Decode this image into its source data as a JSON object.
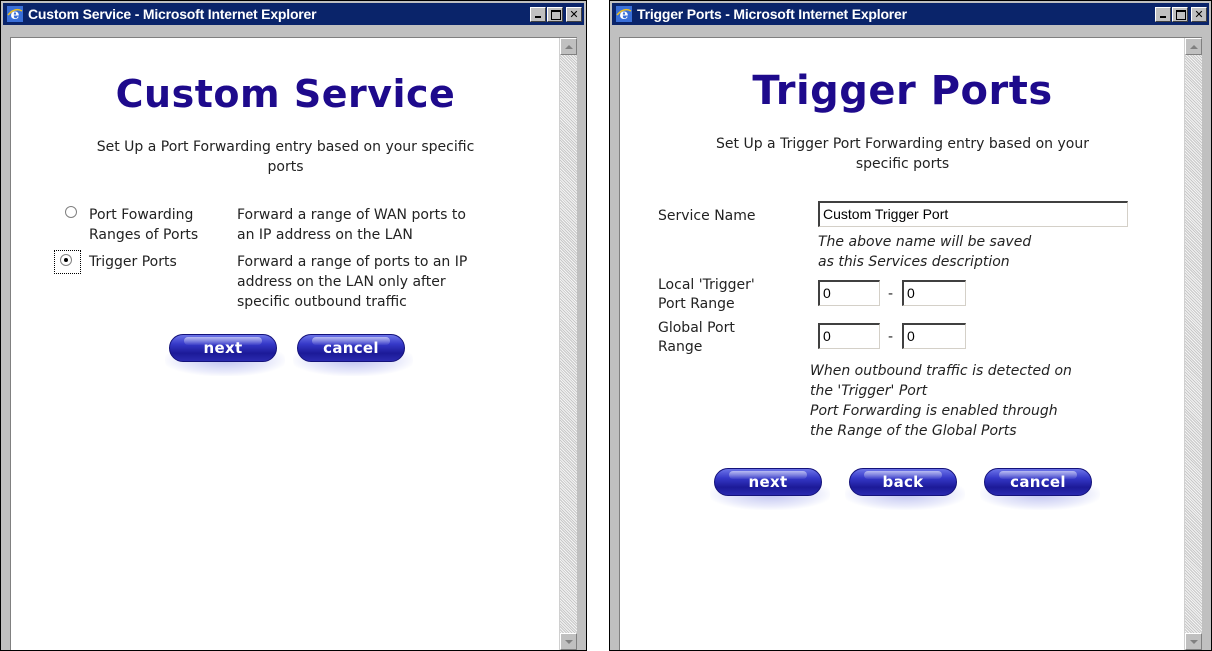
{
  "window1": {
    "title": "Custom Service - Microsoft Internet Explorer",
    "heading": "Custom Service",
    "intro_line1": "Set Up a Port Forwarding entry based on your specific",
    "intro_line2": "ports",
    "options": [
      {
        "label_line1": "Port Fowarding",
        "label_line2": "Ranges of Ports",
        "desc_line1": "Forward a range of WAN ports to",
        "desc_line2": "an IP address on the LAN",
        "desc_line3": "",
        "selected": false
      },
      {
        "label_line1": "Trigger Ports",
        "label_line2": "",
        "desc_line1": "Forward a range of ports to an IP",
        "desc_line2": "address on the LAN only after",
        "desc_line3": "specific outbound traffic",
        "selected": true
      }
    ],
    "buttons": {
      "next": "next",
      "cancel": "cancel"
    }
  },
  "window2": {
    "title": "Trigger Ports - Microsoft Internet Explorer",
    "heading": "Trigger Ports",
    "intro_line1": "Set Up a Trigger Port Forwarding entry based on your",
    "intro_line2": "specific ports",
    "service_name_label": "Service Name",
    "service_name_value": "Custom Trigger Port",
    "service_note_line1": "The above name will be saved",
    "service_note_line2": "as this Services description",
    "local_label_line1": "Local 'Trigger'",
    "local_label_line2": "Port Range",
    "local_from": "0",
    "local_to": "0",
    "global_label_line1": "Global Port",
    "global_label_line2": "Range",
    "global_from": "0",
    "global_to": "0",
    "range_dash": "-",
    "note_line1": "When outbound traffic is detected on",
    "note_line2": "the 'Trigger' Port",
    "note_line3": "Port Forwarding is enabled through",
    "note_line4": "the Range of the Global Ports",
    "buttons": {
      "next": "next",
      "back": "back",
      "cancel": "cancel"
    }
  },
  "colors": {
    "titlebar": "#0a246a",
    "heading": "#1e0a8c",
    "button": "#2b2ab0"
  },
  "icons": [
    "ie-icon",
    "minimize-icon",
    "maximize-icon",
    "close-icon",
    "scroll-up-icon",
    "scroll-down-icon"
  ]
}
